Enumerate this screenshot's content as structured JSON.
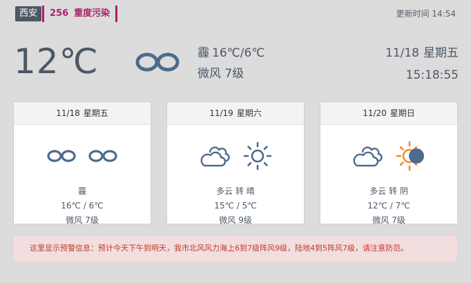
{
  "header": {
    "city": "西安",
    "aqi_value": "256",
    "aqi_label": "重度污染",
    "update_label": "更新时间",
    "update_time": "14:54"
  },
  "current": {
    "temperature": "12℃",
    "condition": "霾",
    "temp_range": "16℃/6℃",
    "wind": "微风 7级",
    "date": "11/18",
    "weekday": "星期五",
    "time": "15:18:55",
    "icon": "haze-icon"
  },
  "forecast": [
    {
      "date": "11/18",
      "weekday": "星期五",
      "condition": "霾",
      "temps": "16℃ / 6℃",
      "wind": "微风 7级",
      "icons": [
        "haze-icon",
        "haze-icon"
      ]
    },
    {
      "date": "11/19",
      "weekday": "星期六",
      "condition": "多云 转 晴",
      "temps": "15℃ / 5℃",
      "wind": "微风 9级",
      "icons": [
        "cloudy-icon",
        "sun-icon"
      ]
    },
    {
      "date": "11/20",
      "weekday": "星期日",
      "condition": "多云 转 阴",
      "temps": "12℃ / 7℃",
      "wind": "微风 7级",
      "icons": [
        "cloudy-icon",
        "partly-sunny-icon"
      ]
    }
  ],
  "alert": {
    "text": "这里显示预警信息：预计今天下午到明天，我市北风风力海上6到7级阵风9级，陆地4到5阵风7级，请注意防范。"
  },
  "colors": {
    "background": "#dcdcdc",
    "text": "#4d5866",
    "aqi": "#b01e6e",
    "alert_bg": "#f2dede",
    "alert_text": "#c0392b",
    "sun": "#f08a24"
  }
}
